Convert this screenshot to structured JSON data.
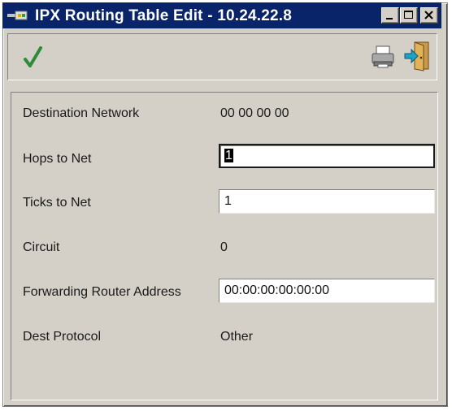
{
  "window": {
    "title": "IPX Routing Table Edit - 10.24.22.8",
    "icon": "network-icon",
    "controls": [
      "minimize-icon",
      "maximize-icon",
      "close-icon"
    ]
  },
  "toolbar": {
    "buttons": [
      {
        "name": "apply",
        "icon": "checkmark-icon",
        "color": "#2e8b3a"
      },
      {
        "name": "print",
        "icon": "printer-icon"
      },
      {
        "name": "exit",
        "icon": "exit-door-icon",
        "color": "#1aa3c9"
      }
    ]
  },
  "form": {
    "destination_network": {
      "label": "Destination Network",
      "value": "00 00 00 00"
    },
    "hops_to_net": {
      "label": "Hops to Net",
      "value": "1"
    },
    "ticks_to_net": {
      "label": "Ticks to Net",
      "value": "1"
    },
    "circuit": {
      "label": "Circuit",
      "value": "0"
    },
    "forwarding_router_address": {
      "label": "Forwarding Router Address",
      "value": "00:00:00:00:00:00"
    },
    "dest_protocol": {
      "label": "Dest Protocol",
      "value": "Other"
    }
  },
  "colors": {
    "titlebar": "#0a246a",
    "face": "#d4d0c8"
  }
}
